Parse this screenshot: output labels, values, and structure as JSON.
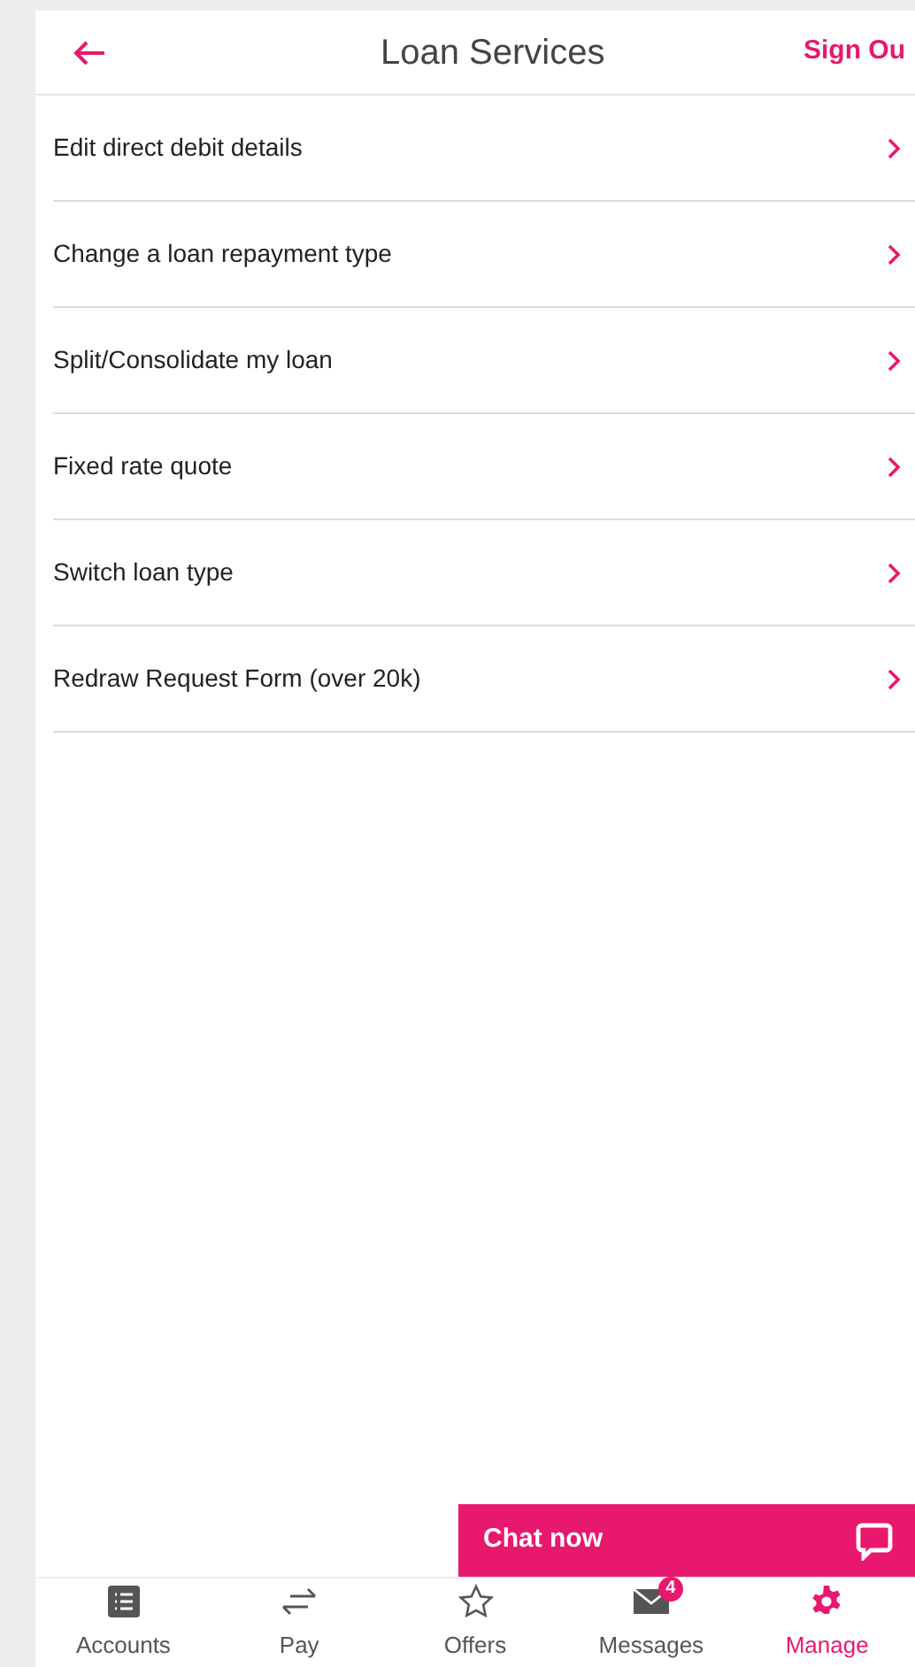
{
  "header": {
    "title": "Loan Services",
    "action": "Sign Ou"
  },
  "items": [
    {
      "label": "Edit direct debit details"
    },
    {
      "label": "Change a loan repayment type"
    },
    {
      "label": "Split/Consolidate my loan"
    },
    {
      "label": "Fixed rate quote"
    },
    {
      "label": "Switch loan type"
    },
    {
      "label": "Redraw Request Form (over 20k)"
    }
  ],
  "chat": {
    "label": "Chat now"
  },
  "tabs": [
    {
      "kind": "accounts",
      "label": "Accounts",
      "selected": false
    },
    {
      "kind": "pay",
      "label": "Pay",
      "selected": false
    },
    {
      "kind": "offers",
      "label": "Offers",
      "selected": false
    },
    {
      "kind": "messages",
      "label": "Messages",
      "selected": false,
      "badge": "4"
    },
    {
      "kind": "manage",
      "label": "Manage",
      "selected": true
    }
  ]
}
